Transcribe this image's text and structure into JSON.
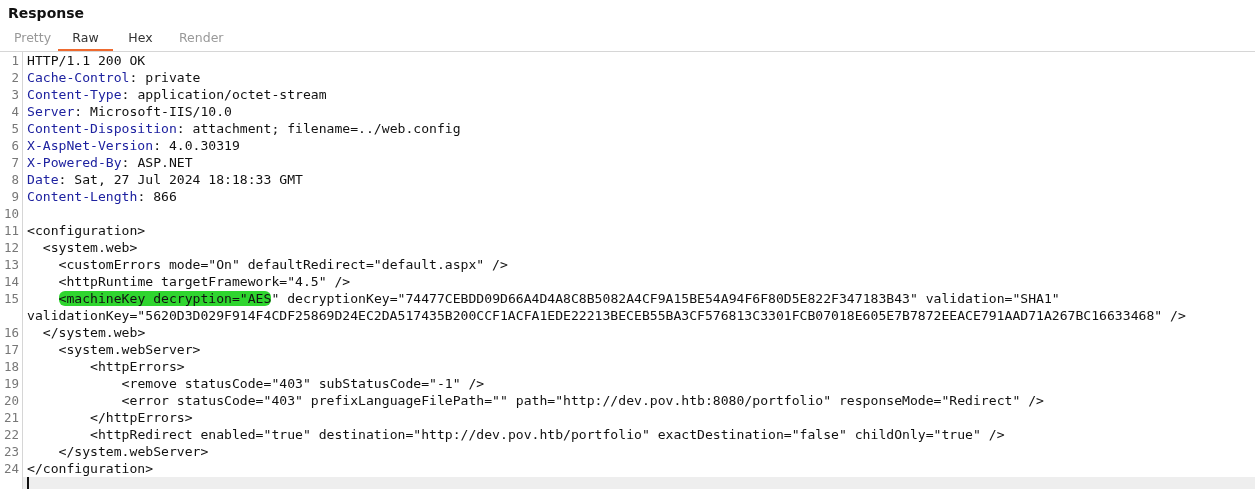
{
  "panel": {
    "title": "Response"
  },
  "tabs": [
    {
      "label": "Pretty",
      "selected": false,
      "disabled": true
    },
    {
      "label": "Raw",
      "selected": true,
      "disabled": false
    },
    {
      "label": "Hex",
      "selected": false,
      "disabled": false
    },
    {
      "label": "Render",
      "selected": false,
      "disabled": true
    }
  ],
  "editor": {
    "lines": [
      {
        "number": "1",
        "kind": "text",
        "segments": [
          {
            "text": "HTTP/1.1 200 OK"
          }
        ]
      },
      {
        "number": "2",
        "kind": "header",
        "name": "Cache-Control",
        "value": ": private"
      },
      {
        "number": "3",
        "kind": "header",
        "name": "Content-Type",
        "value": ": application/octet-stream"
      },
      {
        "number": "4",
        "kind": "header",
        "name": "Server",
        "value": ": Microsoft-IIS/10.0"
      },
      {
        "number": "5",
        "kind": "header",
        "name": "Content-Disposition",
        "value": ": attachment; filename=../web.config"
      },
      {
        "number": "6",
        "kind": "header",
        "name": "X-AspNet-Version",
        "value": ": 4.0.30319"
      },
      {
        "number": "7",
        "kind": "header",
        "name": "X-Powered-By",
        "value": ": ASP.NET"
      },
      {
        "number": "8",
        "kind": "header",
        "name": "Date",
        "value": ": Sat, 27 Jul 2024 18:18:33 GMT"
      },
      {
        "number": "9",
        "kind": "header",
        "name": "Content-Length",
        "value": ": 866"
      },
      {
        "number": "10",
        "kind": "text"
      },
      {
        "number": "11",
        "kind": "text",
        "segments": [
          {
            "text": "<configuration>"
          }
        ]
      },
      {
        "number": "12",
        "kind": "text",
        "segments": [
          {
            "text": "  <system.web>"
          }
        ]
      },
      {
        "number": "13",
        "kind": "text",
        "segments": [
          {
            "text": "    <customErrors mode=\"On\" defaultRedirect=\"default.aspx\" />"
          }
        ]
      },
      {
        "number": "14",
        "kind": "text",
        "segments": [
          {
            "text": "    <httpRuntime targetFramework=\"4.5\" />"
          }
        ]
      },
      {
        "number": "15",
        "kind": "text",
        "segments": [
          {
            "text": "    <machineKey decryption=\"AES",
            "highlighted": true
          },
          {
            "text": "\" decryptionKey=\"74477CEBDD09D66A4D4A8C8B5082A4CF9A15BE54A94F6F80D5E822F347183B43\" validation=\"SHA1\" validationKey=\"5620D3D029F914F4CDF25869D24EC2DA517435B200CCF1ACFA1EDE22213BECEB55BA3CF576813C3301FCB07018E605E7B7872EEACE791AAD71A267BC16633468\" />"
          }
        ]
      },
      {
        "number": "16",
        "kind": "text",
        "segments": [
          {
            "text": "  </system.web>"
          }
        ]
      },
      {
        "number": "17",
        "kind": "text",
        "segments": [
          {
            "text": "    <system.webServer>"
          }
        ]
      },
      {
        "number": "18",
        "kind": "text",
        "segments": [
          {
            "text": "        <httpErrors>"
          }
        ]
      },
      {
        "number": "19",
        "kind": "text",
        "segments": [
          {
            "text": "            <remove statusCode=\"403\" subStatusCode=\"-1\" />"
          }
        ]
      },
      {
        "number": "20",
        "kind": "text",
        "segments": [
          {
            "text": "            <error statusCode=\"403\" prefixLanguageFilePath=\"\" path=\"http://dev.pov.htb:8080/portfolio\" responseMode=\"Redirect\" />"
          }
        ]
      },
      {
        "number": "21",
        "kind": "text",
        "segments": [
          {
            "text": "        </httpErrors>"
          }
        ]
      },
      {
        "number": "22",
        "kind": "text",
        "segments": [
          {
            "text": "        <httpRedirect enabled=\"true\" destination=\"http://dev.pov.htb/portfolio\" exactDestination=\"false\" childOnly=\"true\" />"
          }
        ]
      },
      {
        "number": "23",
        "kind": "text",
        "segments": [
          {
            "text": "    </system.webServer>"
          }
        ]
      },
      {
        "number": "24",
        "kind": "text",
        "segments": [
          {
            "text": "</configuration>"
          }
        ]
      }
    ],
    "cursor_line": {
      "active": true
    }
  }
}
